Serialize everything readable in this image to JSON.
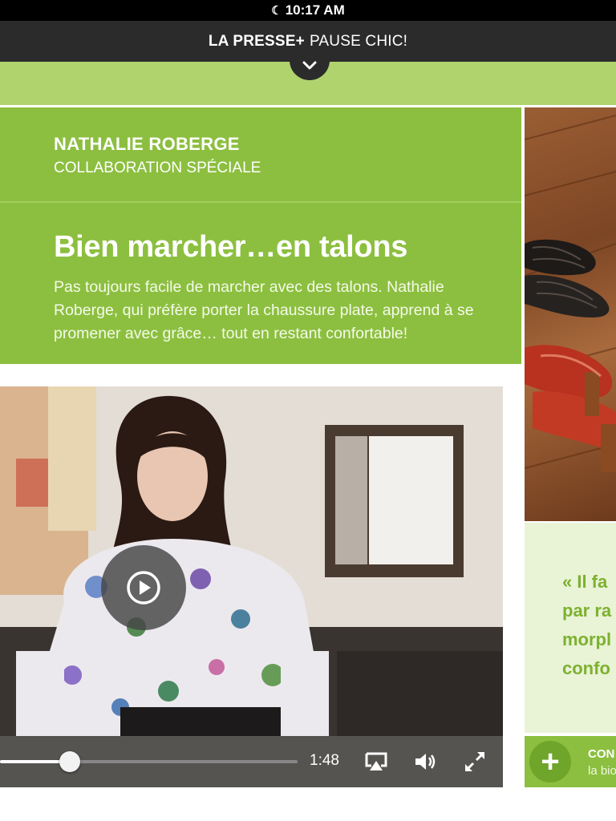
{
  "status_bar": {
    "time": "10:17 AM",
    "icon": "moon-icon"
  },
  "header": {
    "brand": "LA PRESSE+",
    "section": "PAUSE CHIC!",
    "toggle_icon": "chevron-down-icon"
  },
  "article": {
    "author": "NATHALIE ROBERGE",
    "role": "COLLABORATION SPÉCIALE",
    "title": "Bien marcher…en talons",
    "summary": "Pas toujours facile de marcher avec des talons. Nathalie Roberge, qui préfère porter la chaussure plate, apprend à se promener avec grâce… tout en restant confortable!"
  },
  "video": {
    "elapsed": "1:48",
    "progress": 0.235,
    "play_icon": "play-icon",
    "airplay_icon": "airplay-icon",
    "volume_icon": "volume-icon",
    "fullscreen_icon": "fullscreen-icon"
  },
  "sidebar": {
    "quote_lines": [
      "« Il fa",
      "par ra",
      "morpl",
      "confo"
    ],
    "more_title": "CON",
    "more_sub": "la bio",
    "more_icon": "plus-icon"
  },
  "colors": {
    "accent": "#8cbf3f",
    "accent_light": "#b0d36e",
    "quote": "#7db12f",
    "header_bg": "#2b2b2b"
  }
}
